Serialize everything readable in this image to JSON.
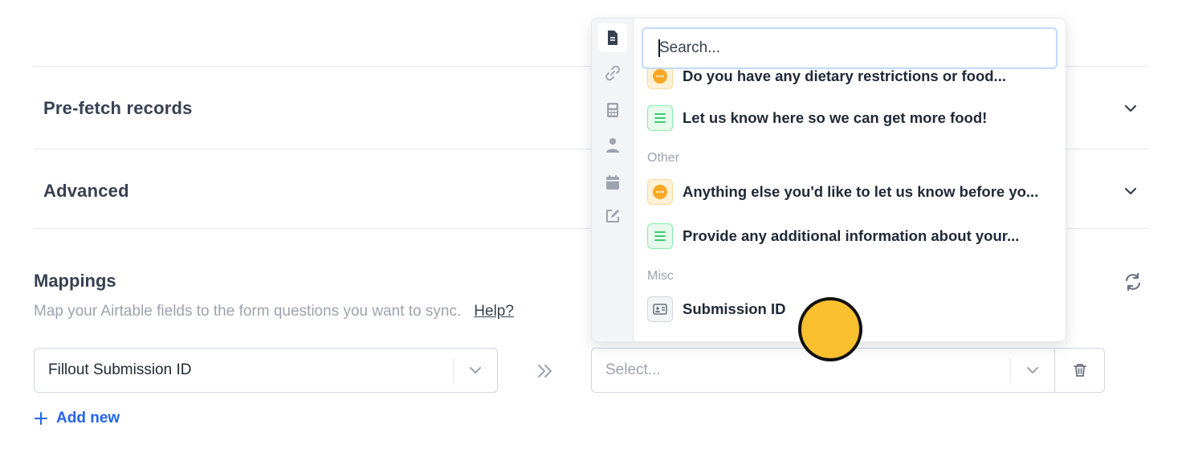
{
  "sections": [
    {
      "title": "Pre-fetch records"
    },
    {
      "title": "Advanced"
    }
  ],
  "mappings": {
    "title": "Mappings",
    "subtitle": "Map your Airtable fields to the form questions you want to sync.",
    "help_label": "Help?"
  },
  "mapping_row": {
    "left_value": "Fillout Submission ID",
    "right_placeholder": "Select..."
  },
  "add_new_label": "Add new",
  "dropdown": {
    "search_placeholder": "Search...",
    "rail_icons": [
      "document-icon",
      "link-icon",
      "calculator-icon",
      "person-icon",
      "calendar-icon",
      "edit-icon"
    ],
    "options": [
      {
        "label": "Do you have any dietary restrictions or food...",
        "type": "multiple-choice"
      },
      {
        "label": "Let us know here so we can get more food!",
        "type": "long-text"
      }
    ],
    "groups": [
      {
        "name": "Other",
        "options": [
          {
            "label": "Anything else you'd like to let us know before yo...",
            "type": "multiple-choice"
          },
          {
            "label": "Provide any additional information about your...",
            "type": "long-text"
          }
        ]
      },
      {
        "name": "Misc",
        "options": [
          {
            "label": "Submission ID",
            "type": "id"
          }
        ]
      }
    ]
  },
  "colors": {
    "accent": "#2563eb",
    "cursor": "#fbc02d"
  }
}
